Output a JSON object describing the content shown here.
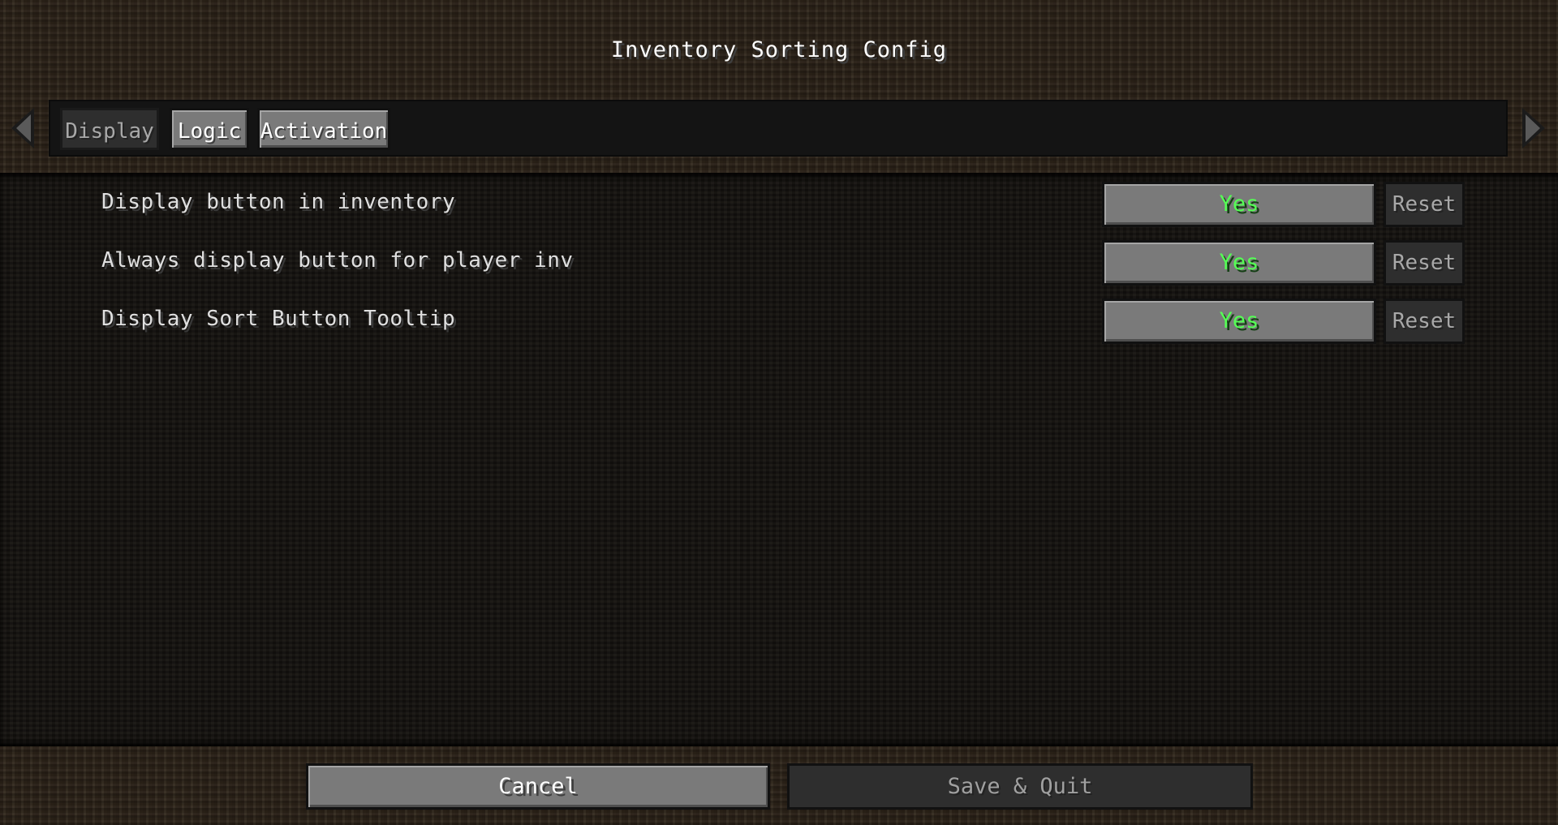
{
  "window": {
    "title": "Inventory Sorting Config"
  },
  "tabs": [
    {
      "label": "Display",
      "active": true
    },
    {
      "label": "Logic",
      "active": false
    },
    {
      "label": "Activation",
      "active": false
    }
  ],
  "options": [
    {
      "label": "Display button in inventory",
      "value": "Yes",
      "reset_label": "Reset"
    },
    {
      "label": "Always display button for player inv",
      "value": "Yes",
      "reset_label": "Reset"
    },
    {
      "label": "Display Sort Button Tooltip",
      "value": "Yes",
      "reset_label": "Reset"
    }
  ],
  "footer": {
    "cancel_label": "Cancel",
    "save_label": "Save & Quit"
  },
  "icons": {
    "nav_left": "arrow-left-icon",
    "nav_right": "arrow-right-icon"
  },
  "colors": {
    "value_true": "#55ff55",
    "button_gray": "#7a7a7a",
    "button_disabled": "#2e2e2e"
  }
}
